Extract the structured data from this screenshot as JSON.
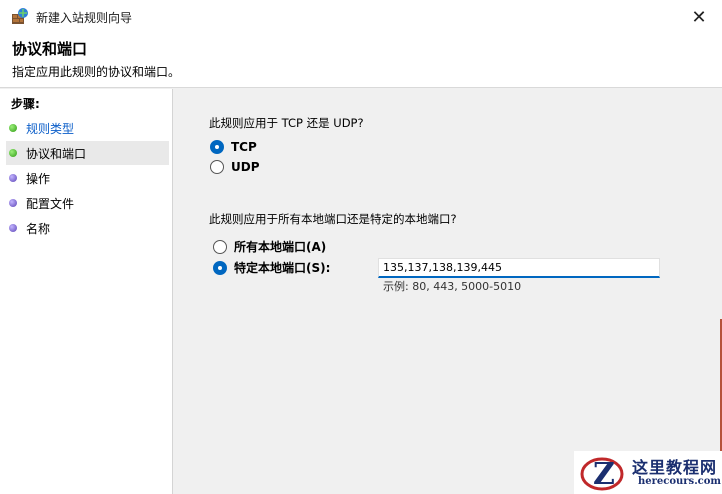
{
  "window": {
    "title": "新建入站规则向导",
    "close_glyph": "✕"
  },
  "header": {
    "title": "协议和端口",
    "subtitle": "指定应用此规则的协议和端口。"
  },
  "steps": {
    "title": "步骤:",
    "items": [
      {
        "label": "规则类型",
        "status": "green",
        "link": true
      },
      {
        "label": "协议和端口",
        "status": "green",
        "active": true
      },
      {
        "label": "操作",
        "status": "purple"
      },
      {
        "label": "配置文件",
        "status": "purple"
      },
      {
        "label": "名称",
        "status": "purple"
      }
    ]
  },
  "protocol": {
    "question": "此规则应用于 TCP 还是 UDP?",
    "options": [
      {
        "label": "TCP",
        "checked": true
      },
      {
        "label": "UDP",
        "checked": false
      }
    ]
  },
  "ports": {
    "question": "此规则应用于所有本地端口还是特定的本地端口?",
    "options": [
      {
        "label": "所有本地端口(A)",
        "checked": false
      },
      {
        "label": "特定本地端口(S):",
        "checked": true
      }
    ],
    "value": "135,137,138,139,445",
    "example": "示例: 80, 443, 5000-5010"
  },
  "watermark": {
    "cn": "这里教程网",
    "en": "herecours.com"
  },
  "colors": {
    "accent": "#0067c0",
    "link": "#0b5ec9",
    "watermark": "#1b2f70"
  }
}
